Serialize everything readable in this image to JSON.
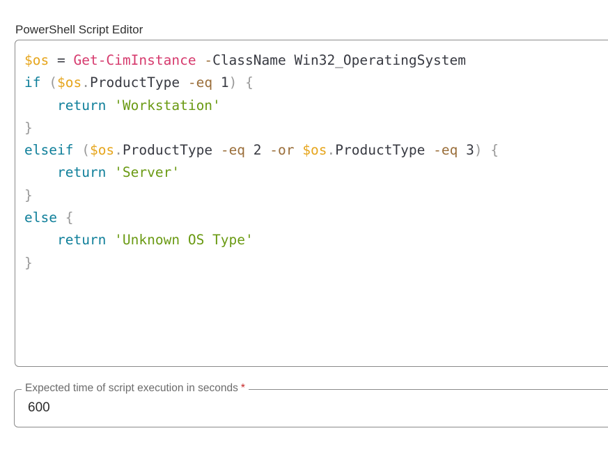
{
  "editor": {
    "label": "PowerShell Script Editor",
    "code_lines": [
      [
        {
          "t": "var",
          "v": "$os"
        },
        {
          "t": "txt",
          "v": " = "
        },
        {
          "t": "cmd",
          "v": "Get-CimInstance"
        },
        {
          "t": "txt",
          "v": " "
        },
        {
          "t": "op",
          "v": "-"
        },
        {
          "t": "txt",
          "v": "ClassName Win32_OperatingSystem"
        }
      ],
      [
        {
          "t": "kw",
          "v": "if"
        },
        {
          "t": "txt",
          "v": " "
        },
        {
          "t": "pun",
          "v": "("
        },
        {
          "t": "var",
          "v": "$os"
        },
        {
          "t": "pun",
          "v": "."
        },
        {
          "t": "txt",
          "v": "ProductType "
        },
        {
          "t": "op",
          "v": "-eq"
        },
        {
          "t": "txt",
          "v": " 1"
        },
        {
          "t": "pun",
          "v": ")"
        },
        {
          "t": "txt",
          "v": " "
        },
        {
          "t": "pun",
          "v": "{"
        }
      ],
      [
        {
          "t": "txt",
          "v": "    "
        },
        {
          "t": "kw",
          "v": "return"
        },
        {
          "t": "txt",
          "v": " "
        },
        {
          "t": "str",
          "v": "'Workstation'"
        }
      ],
      [
        {
          "t": "pun",
          "v": "}"
        }
      ],
      [
        {
          "t": "kw",
          "v": "elseif"
        },
        {
          "t": "txt",
          "v": " "
        },
        {
          "t": "pun",
          "v": "("
        },
        {
          "t": "var",
          "v": "$os"
        },
        {
          "t": "pun",
          "v": "."
        },
        {
          "t": "txt",
          "v": "ProductType "
        },
        {
          "t": "op",
          "v": "-eq"
        },
        {
          "t": "txt",
          "v": " 2 "
        },
        {
          "t": "op",
          "v": "-or"
        },
        {
          "t": "txt",
          "v": " "
        },
        {
          "t": "var",
          "v": "$os"
        },
        {
          "t": "pun",
          "v": "."
        },
        {
          "t": "txt",
          "v": "ProductType "
        },
        {
          "t": "op",
          "v": "-eq"
        },
        {
          "t": "txt",
          "v": " 3"
        },
        {
          "t": "pun",
          "v": ")"
        },
        {
          "t": "txt",
          "v": " "
        },
        {
          "t": "pun",
          "v": "{"
        }
      ],
      [
        {
          "t": "txt",
          "v": "    "
        },
        {
          "t": "kw",
          "v": "return"
        },
        {
          "t": "txt",
          "v": " "
        },
        {
          "t": "str",
          "v": "'Server'"
        }
      ],
      [
        {
          "t": "pun",
          "v": "}"
        }
      ],
      [
        {
          "t": "kw",
          "v": "else"
        },
        {
          "t": "txt",
          "v": " "
        },
        {
          "t": "pun",
          "v": "{"
        }
      ],
      [
        {
          "t": "txt",
          "v": "    "
        },
        {
          "t": "kw",
          "v": "return"
        },
        {
          "t": "txt",
          "v": " "
        },
        {
          "t": "str",
          "v": "'Unknown OS Type'"
        }
      ],
      [
        {
          "t": "pun",
          "v": "}"
        }
      ]
    ]
  },
  "execution_time": {
    "label": "Expected time of script execution in seconds",
    "required_mark": "*",
    "value": "600"
  },
  "colors": {
    "variable": "#e6a51c",
    "cmdlet": "#d63b6e",
    "operator": "#9a6e3a",
    "keyword": "#0f7f9a",
    "string": "#6a9a13",
    "punctuation": "#999999",
    "required": "#c62828"
  }
}
